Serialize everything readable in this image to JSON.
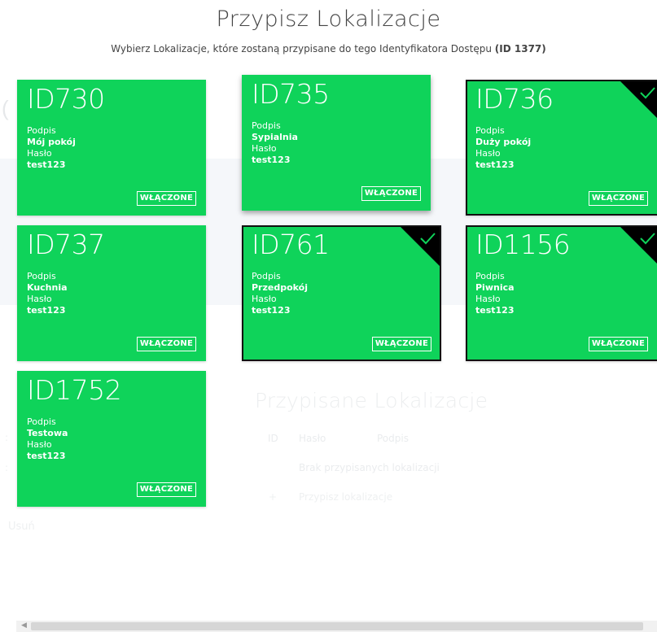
{
  "modal": {
    "title": "Przypisz Lokalizacje",
    "subtitle_text": "Wybierz Lokalizacje, które zostaną przypisane do tego Identyfikatora Dostępu ",
    "subtitle_id": "(ID 1377)"
  },
  "cards": [
    {
      "id": "ID730",
      "podpis_label": "Podpis",
      "podpis": "Mój pokój",
      "haslo_label": "Hasło",
      "haslo": "test123",
      "status": "WŁĄCZONE",
      "selected": false
    },
    {
      "id": "ID735",
      "podpis_label": "Podpis",
      "podpis": "Sypialnia",
      "haslo_label": "Hasło",
      "haslo": "test123",
      "status": "WŁĄCZONE",
      "selected": false
    },
    {
      "id": "ID736",
      "podpis_label": "Podpis",
      "podpis": "Duży pokój",
      "haslo_label": "Hasło",
      "haslo": "test123",
      "status": "WŁĄCZONE",
      "selected": true
    },
    {
      "id": "ID737",
      "podpis_label": "Podpis",
      "podpis": "Kuchnia",
      "haslo_label": "Hasło",
      "haslo": "test123",
      "status": "WŁĄCZONE",
      "selected": false
    },
    {
      "id": "ID761",
      "podpis_label": "Podpis",
      "podpis": "Przedpokój",
      "haslo_label": "Hasło",
      "haslo": "test123",
      "status": "WŁĄCZONE",
      "selected": true
    },
    {
      "id": "ID1156",
      "podpis_label": "Podpis",
      "podpis": "Piwnica",
      "haslo_label": "Hasło",
      "haslo": "test123",
      "status": "WŁĄCZONE",
      "selected": true
    },
    {
      "id": "ID1752",
      "podpis_label": "Podpis",
      "podpis": "Testowa",
      "haslo_label": "Hasło",
      "haslo": "test123",
      "status": "WŁĄCZONE",
      "selected": false
    }
  ],
  "background": {
    "heading": "Przypisane Lokalizacje",
    "columns": [
      "ID",
      "Hasło",
      "Podpis"
    ],
    "empty_text": "Brak przypisanych lokalizacji",
    "add_plus": "+",
    "add_text": "Przypisz lokalizacje",
    "bottom_text": "Usuń"
  },
  "colors": {
    "card_green": "#0fd35a",
    "selected_border": "#111111",
    "overlay": "#ffffff"
  },
  "icons": {
    "selected_marker": "check-icon",
    "scroll_left": "chevron-left-icon"
  }
}
